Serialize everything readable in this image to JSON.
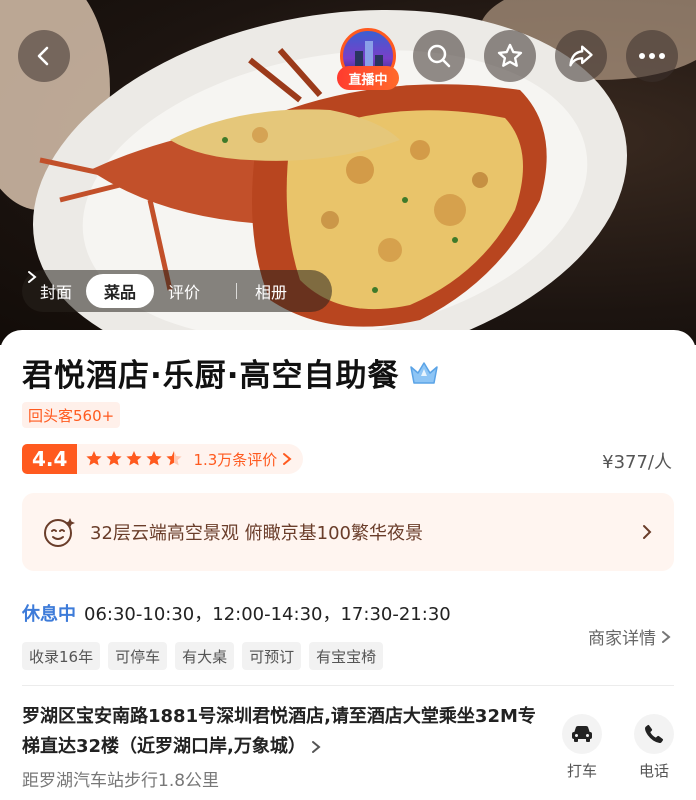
{
  "nav": {
    "back_icon": "chevron-left-icon",
    "search_icon": "search-icon",
    "favorite_icon": "star-outline-icon",
    "share_icon": "share-icon",
    "more_icon": "more-dots-icon"
  },
  "live": {
    "badge": "直播中"
  },
  "media_tabs": {
    "items": [
      {
        "label": "封面",
        "active": false
      },
      {
        "label": "菜品",
        "active": true
      },
      {
        "label": "评价",
        "active": false
      }
    ],
    "album": "相册"
  },
  "restaurant": {
    "name": "君悦酒店·乐厨·高空自助餐",
    "repeat_customers": "回头客560+",
    "rating": "4.4",
    "stars": 4.5,
    "review_count": "1.3万条评价",
    "price": "¥377/人"
  },
  "promo": {
    "text": "32层云端高空景观  俯瞰京基100繁华夜景"
  },
  "hours": {
    "status": "休息中",
    "times": "06:30-10:30，12:00-14:30，17:30-21:30"
  },
  "feature_tags": [
    "收录16年",
    "可停车",
    "有大桌",
    "可预订",
    "有宝宝椅"
  ],
  "merchant_detail": "商家详情",
  "address": {
    "text": "罗湖区宝安南路1881号深圳君悦酒店,请至酒店大堂乘坐32M专梯直达32楼（近罗湖口岸,万象城）",
    "distance": "距罗湖汽车站步行1.8公里"
  },
  "actions": [
    {
      "label": "打车",
      "icon": "car-icon"
    },
    {
      "label": "电话",
      "icon": "phone-icon"
    }
  ],
  "colors": {
    "accent": "#ff5a1f",
    "status_blue": "#3d7bd9",
    "promo_bg": "#fff5f0"
  }
}
